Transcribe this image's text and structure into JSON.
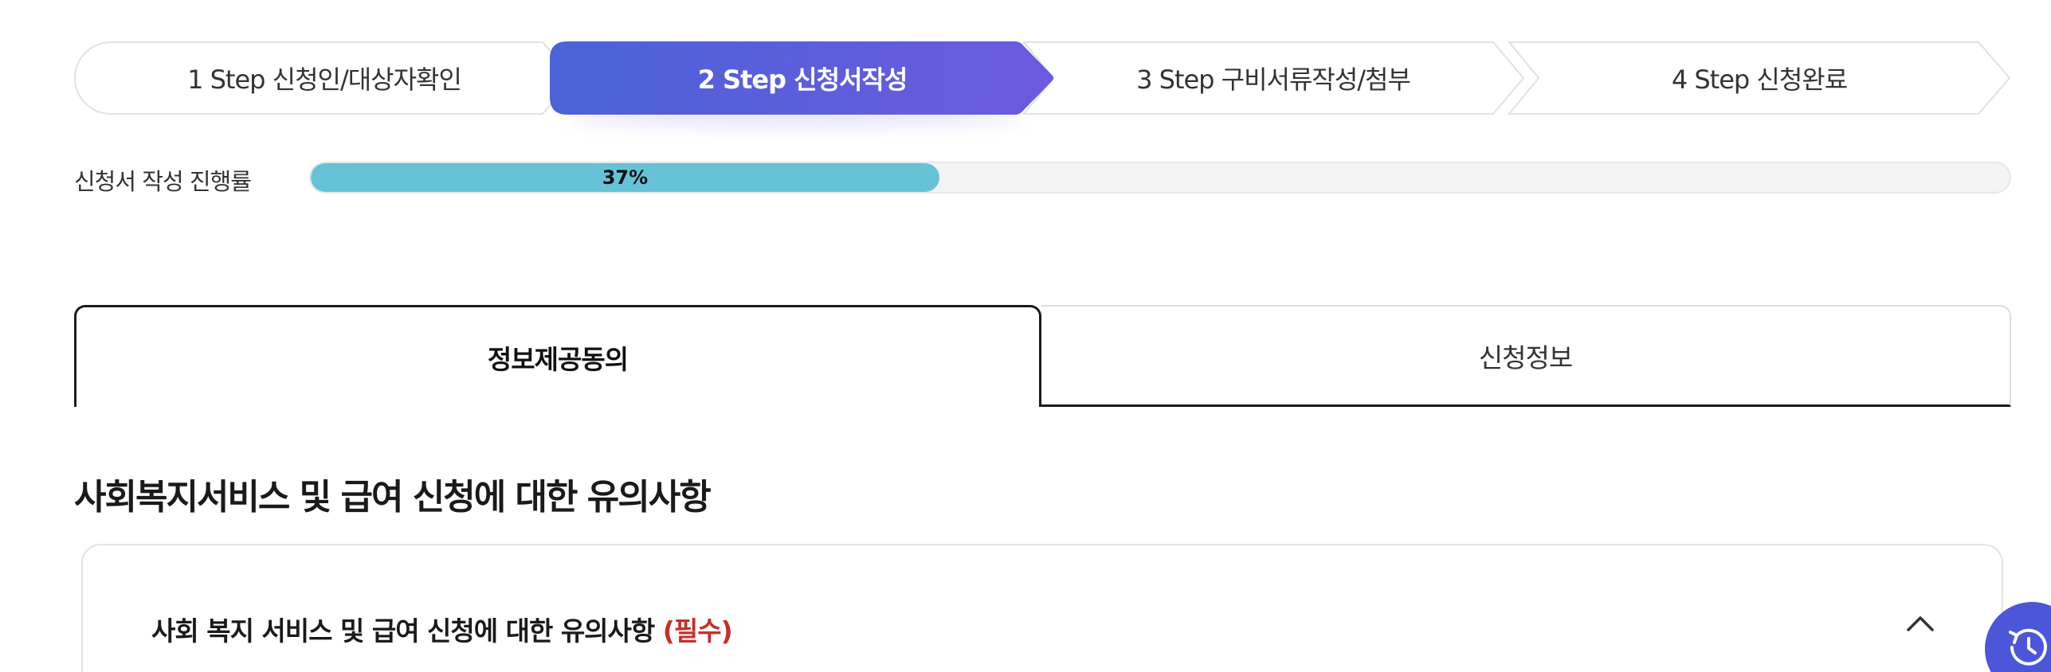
{
  "steps": [
    {
      "label": "1 Step 신청인/대상자확인",
      "state": "done"
    },
    {
      "label": "2 Step 신청서작성",
      "state": "active"
    },
    {
      "label": "3 Step 구비서류작성/첨부",
      "state": "todo"
    },
    {
      "label": "4 Step 신청완료",
      "state": "todo"
    }
  ],
  "progress": {
    "label": "신청서 작성 진행률",
    "value_text": "37%",
    "fraction": 0.37
  },
  "tabs": [
    {
      "label": "정보제공동의",
      "active": true
    },
    {
      "label": "신청정보",
      "active": false
    }
  ],
  "section": {
    "title": "사회복지서비스 및 급여 신청에 대한 유의사항",
    "card": {
      "header": "사회 복지 서비스 및 급여 신청에 대한 유의사항",
      "required": "(필수)",
      "toggle_icon": "chevron-up-icon"
    }
  },
  "float_button": {
    "icon": "history-icon"
  },
  "colors": {
    "step_active_start": "#4a63d6",
    "step_active_end": "#6c5ae0",
    "progress_fill": "#66c3d7",
    "required": "#c6302c",
    "float_button": "#4b57d8"
  }
}
